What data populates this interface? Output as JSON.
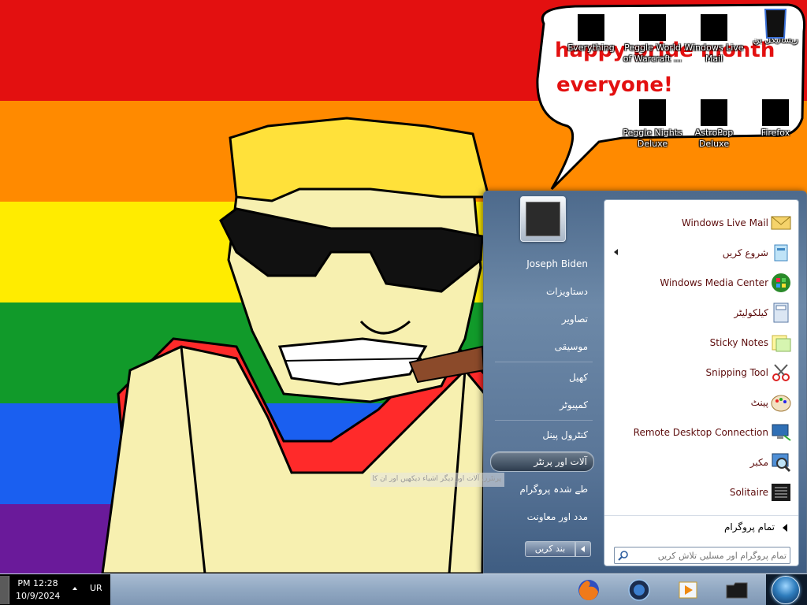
{
  "desktop": {
    "bubble_text_line1": "happy pride month",
    "bubble_text_line2": "everyone!",
    "icons": [
      {
        "label": "Everything",
        "icon": "everything-icon"
      },
      {
        "label": "Peggle World of Warcraft ...",
        "icon": "peggle-wow-icon"
      },
      {
        "label": "Windows Live Mail",
        "icon": "windows-live-mail-icon"
      },
      {
        "label": "ریسائیکل بن",
        "icon": "recycle-bin-icon"
      },
      {
        "label": "Peggle Nights Deluxe",
        "icon": "peggle-nights-icon"
      },
      {
        "label": "AstroPop Deluxe",
        "icon": "astropop-icon"
      },
      {
        "label": "Firefox",
        "icon": "firefox-icon"
      }
    ]
  },
  "start_menu": {
    "pinned": [
      {
        "label": "Windows Live Mail",
        "icon": "mail-icon",
        "has_arrow": false
      },
      {
        "label": "شروع کریں",
        "icon": "getting-started-icon",
        "has_arrow": true
      },
      {
        "label": "Windows Media Center",
        "icon": "media-center-icon",
        "has_arrow": false
      },
      {
        "label": "کیلکولیٹر",
        "icon": "calculator-icon",
        "has_arrow": false
      },
      {
        "label": "Sticky Notes",
        "icon": "sticky-notes-icon",
        "has_arrow": false
      },
      {
        "label": "Snipping Tool",
        "icon": "snipping-tool-icon",
        "has_arrow": false
      },
      {
        "label": "پینٹ",
        "icon": "paint-icon",
        "has_arrow": false
      },
      {
        "label": "Remote Desktop Connection",
        "icon": "remote-desktop-icon",
        "has_arrow": false
      },
      {
        "label": "مکبر",
        "icon": "magnifier-icon",
        "has_arrow": false
      },
      {
        "label": "Solitaire",
        "icon": "solitaire-icon",
        "has_arrow": false
      }
    ],
    "all_programs": "تمام پروگرام",
    "search_placeholder": "تمام پروگرام اور مسلیں تلاش کریں",
    "places": {
      "user": "Joseph Biden",
      "documents": "دستاویزات",
      "pictures": "تصاویر",
      "music": "موسیقی",
      "games": "کھیل",
      "computer": "کمپیوٹر",
      "control_panel": "کنٹرول پینل",
      "devices": "آلات اور پرنٹر",
      "default_programs": "طے شدہ پروگرام",
      "help": "مدد اور معاونت"
    },
    "shutdown": "بند کریں",
    "tooltip": "پرنٹرز، آلات اور ديگر اشیاء دیکھیں اور ان کا نظم کریں"
  },
  "taskbar": {
    "time": "PM 12:28",
    "date": "10/9/2024",
    "language": "UR",
    "pinned": [
      "firefox-icon",
      "ie-icon",
      "media-player-icon",
      "folder-icon"
    ]
  }
}
